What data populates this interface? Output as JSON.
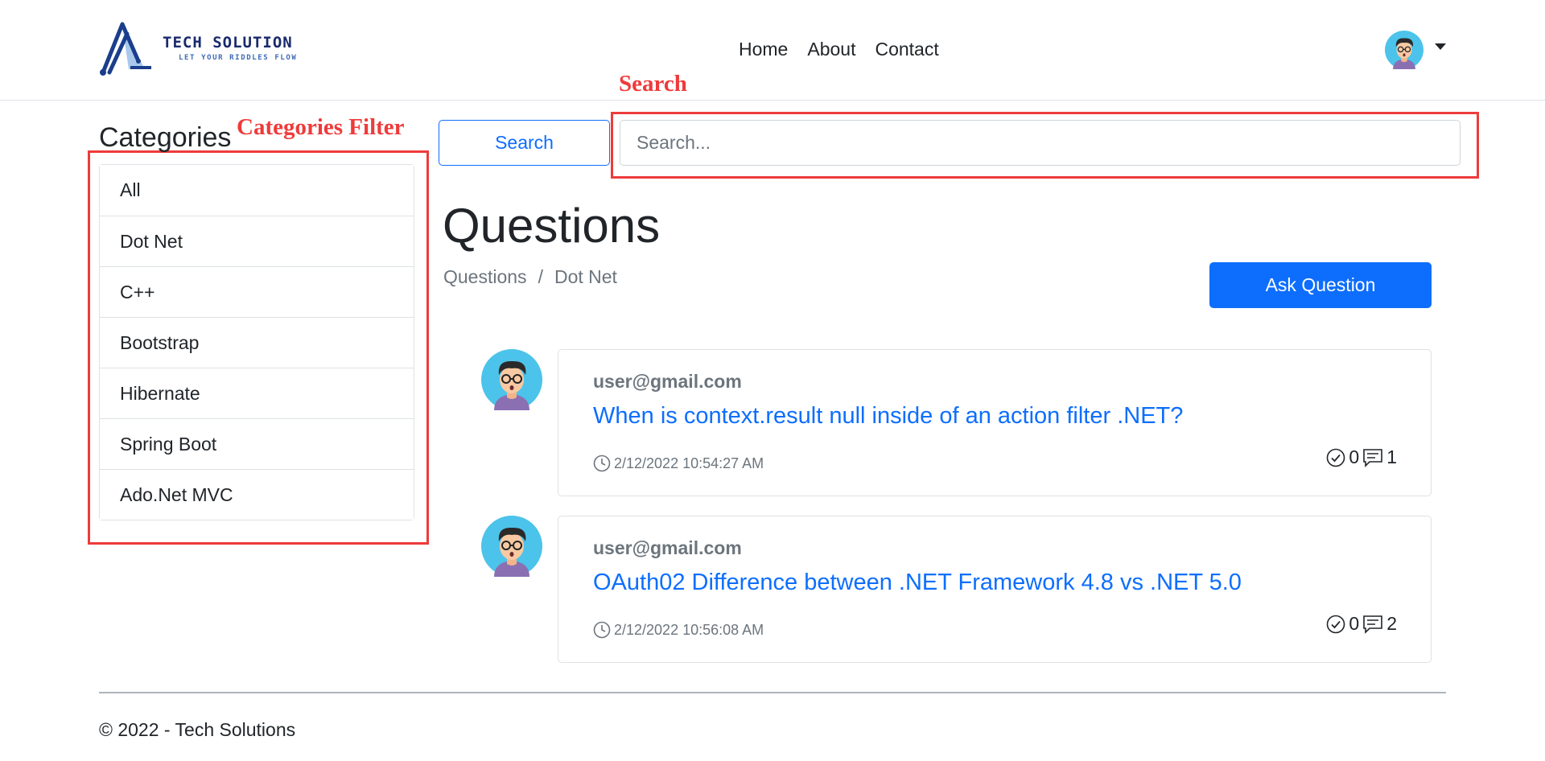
{
  "header": {
    "logo_title": "TECH SOLUTION",
    "logo_subtitle": "LET YOUR RIDDLES FLOW",
    "nav": [
      {
        "label": "Home"
      },
      {
        "label": "About"
      },
      {
        "label": "Contact"
      }
    ]
  },
  "annotations": {
    "search_label": "Search",
    "categories_label": "Categories Filter",
    "color": "#ee3b3b"
  },
  "sidebar": {
    "title": "Categories",
    "items": [
      {
        "label": "All"
      },
      {
        "label": "Dot Net"
      },
      {
        "label": "C++"
      },
      {
        "label": "Bootstrap"
      },
      {
        "label": "Hibernate"
      },
      {
        "label": "Spring Boot"
      },
      {
        "label": "Ado.Net MVC"
      }
    ]
  },
  "search": {
    "button_label": "Search",
    "placeholder": "Search..."
  },
  "main": {
    "title": "Questions",
    "breadcrumb": {
      "root": "Questions",
      "separator": "/",
      "current": "Dot Net"
    },
    "ask_button": "Ask Question",
    "questions": [
      {
        "user": "user@gmail.com",
        "title": "When is context.result null inside of an action filter .NET?",
        "date": "2/12/2022 10:54:27 AM",
        "accepted": "0",
        "answers": "1"
      },
      {
        "user": "user@gmail.com",
        "title": "OAuth02 Difference between .NET Framework 4.8 vs .NET 5.0",
        "date": "2/12/2022 10:56:08 AM",
        "accepted": "0",
        "answers": "2"
      }
    ]
  },
  "footer": {
    "text": "© 2022 - Tech Solutions"
  },
  "colors": {
    "primary": "#0d6efd",
    "muted": "#6c757d",
    "border": "#dee2e6",
    "avatar_bg": "#4cc3ea"
  }
}
